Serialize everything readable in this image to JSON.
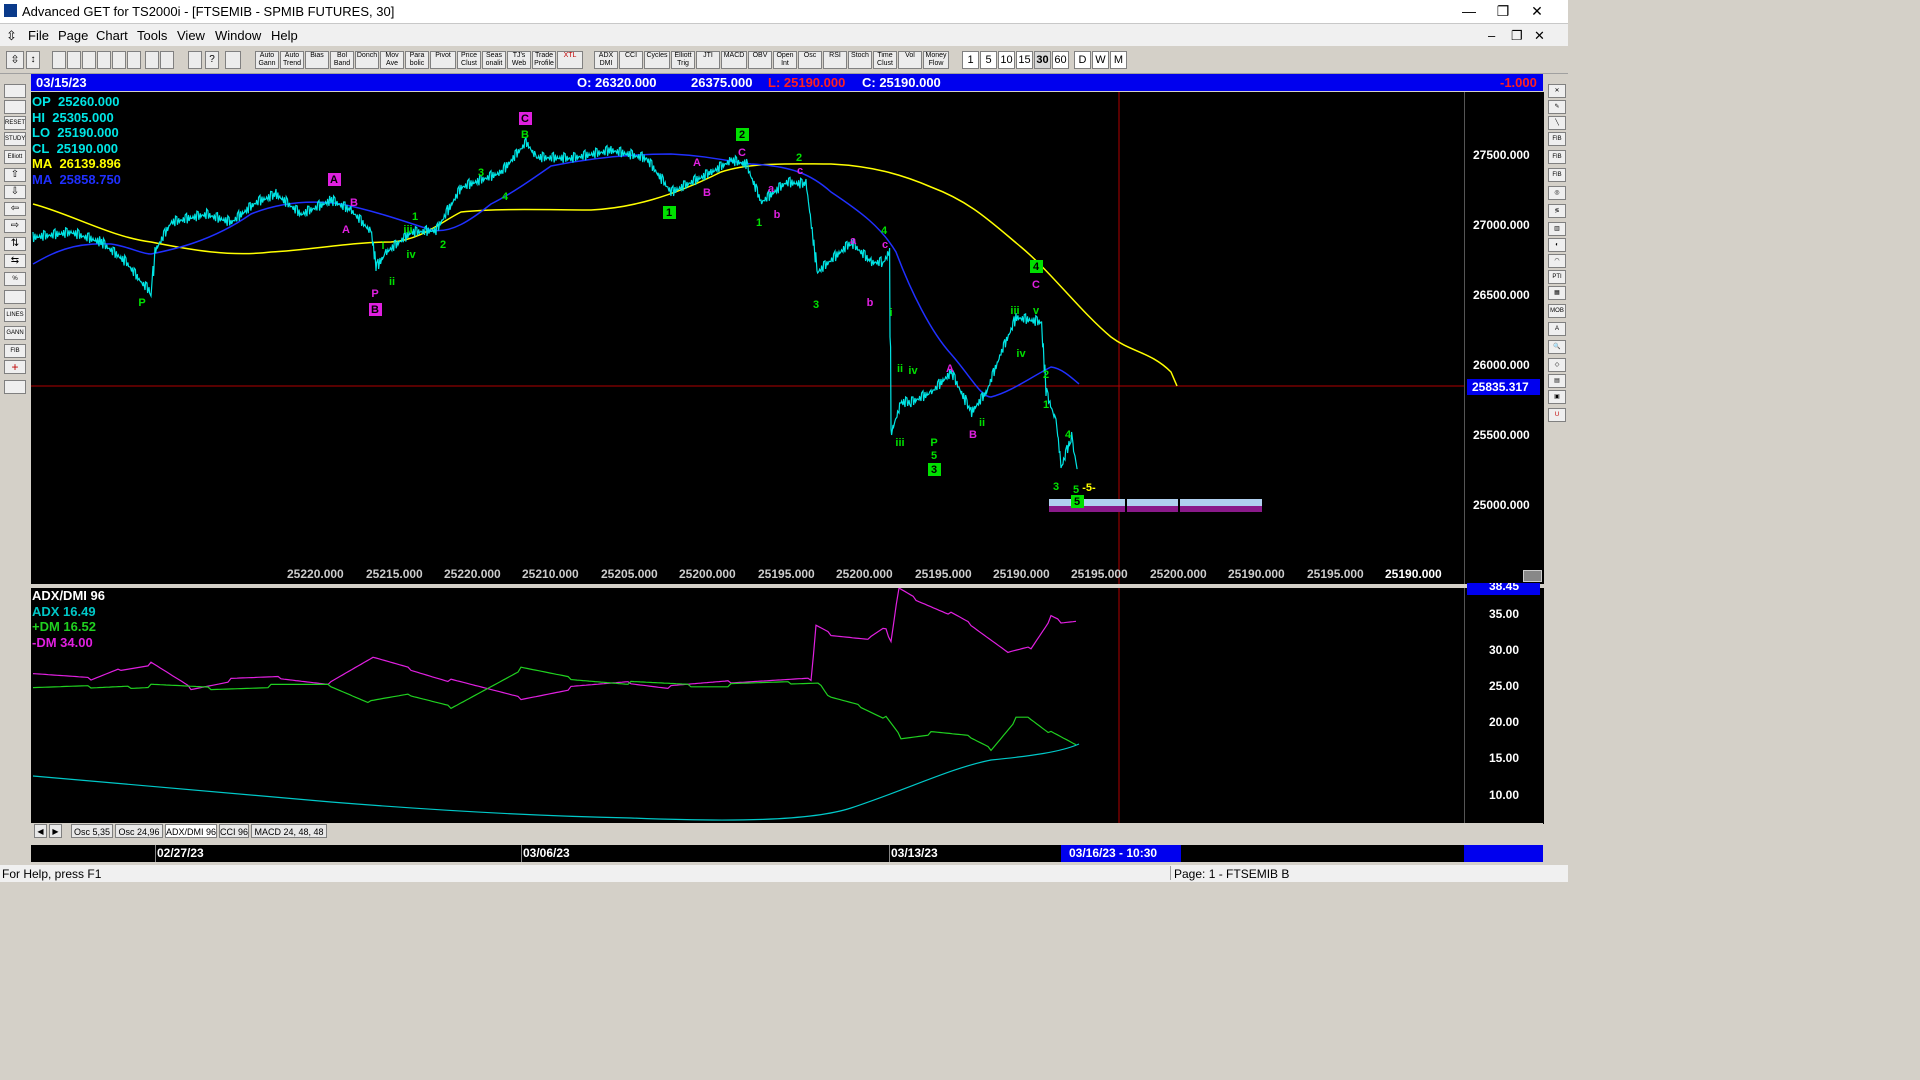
{
  "window": {
    "title": "Advanced GET for TS2000i - [FTSEMIB - SPMIB FUTURES, 30]",
    "controls": [
      "minimize-icon",
      "restore-icon",
      "close-icon"
    ]
  },
  "menu": [
    "File",
    "Page",
    "Chart",
    "Tools",
    "View",
    "Window",
    "Help"
  ],
  "toolbar": {
    "buttons": [
      "Auto Gann",
      "Auto Trend",
      "Bias",
      "Bol Band",
      "Donch",
      "Mov Ave",
      "Para bolic",
      "Pivot",
      "Price Clust",
      "Seas onalit",
      "TJ's Web",
      "Trade Profile",
      "XTL",
      "ADX DMI",
      "CCI",
      "Cycles",
      "Elliott Trig",
      "JTI",
      "MACD",
      "OBV",
      "Open Int",
      "Osc",
      "RSI",
      "Stoch",
      "Time Clust",
      "Vol",
      "Money Flow"
    ],
    "timeframes": [
      "1",
      "5",
      "10",
      "15",
      "30",
      "60",
      "D",
      "W",
      "M"
    ],
    "selected_timeframe": "30"
  },
  "info": {
    "date": "03/15/23",
    "open": "O: 26320.000",
    "high": "26375.000",
    "low": "L: 25190.000",
    "close": "C: 25190.000",
    "change": "-1.000"
  },
  "legend": [
    {
      "label": "OP",
      "value": "25260.000",
      "color": "#00e5e5"
    },
    {
      "label": "HI",
      "value": "25305.000",
      "color": "#00e5e5"
    },
    {
      "label": "LO",
      "value": "25190.000",
      "color": "#00e5e5"
    },
    {
      "label": "CL",
      "value": "25190.000",
      "color": "#00e5e5"
    },
    {
      "label": "MA",
      "value": "26139.896",
      "color": "#ffff00"
    },
    {
      "label": "MA",
      "value": "25858.750",
      "color": "#2020ff"
    }
  ],
  "price_axis": {
    "ticks": [
      "27500.000",
      "27000.000",
      "26500.000",
      "26000.000",
      "25500.000",
      "25000.000"
    ],
    "current_marker": "25835.317"
  },
  "bottom_values": [
    "25220.000",
    "25215.000",
    "25220.000",
    "25210.000",
    "25205.000",
    "25200.000",
    "25195.000",
    "25200.000",
    "25195.000",
    "25190.000",
    "25195.000",
    "25200.000",
    "25190.000",
    "25195.000",
    "25190.000"
  ],
  "wave_labels": [
    {
      "text": "P",
      "color": "#00e000",
      "box": false
    },
    {
      "text": "A",
      "color": "#e020e0",
      "box": true
    },
    {
      "text": "B",
      "color": "#e020e0",
      "box": false
    },
    {
      "text": "A",
      "color": "#e020e0",
      "box": false
    },
    {
      "text": "1",
      "color": "#00e000",
      "box": false
    },
    {
      "text": "iii",
      "color": "#00e000",
      "box": false
    },
    {
      "text": "iv",
      "color": "#00e000",
      "box": false
    },
    {
      "text": "2",
      "color": "#00e000",
      "box": false
    },
    {
      "text": "i",
      "color": "#00e000",
      "box": false
    },
    {
      "text": "ii",
      "color": "#00e000",
      "box": false
    },
    {
      "text": "P",
      "color": "#e020e0",
      "box": false
    },
    {
      "text": "B",
      "color": "#e020e0",
      "box": true
    },
    {
      "text": "3",
      "color": "#00e000",
      "box": false
    },
    {
      "text": "4",
      "color": "#00e000",
      "box": false
    },
    {
      "text": "C",
      "color": "#e020e0",
      "box": true
    },
    {
      "text": "B",
      "color": "#00e000",
      "box": false
    },
    {
      "text": "A",
      "color": "#e020e0",
      "box": false
    },
    {
      "text": "B",
      "color": "#e020e0",
      "box": false
    },
    {
      "text": "1",
      "color": "#00e000",
      "box": true
    },
    {
      "text": "2",
      "color": "#00e000",
      "box": true
    },
    {
      "text": "C",
      "color": "#e020e0",
      "box": false
    },
    {
      "text": "a",
      "color": "#e020e0",
      "box": false
    },
    {
      "text": "b",
      "color": "#e020e0",
      "box": false
    },
    {
      "text": "1",
      "color": "#00e000",
      "box": false
    },
    {
      "text": "2",
      "color": "#00e000",
      "box": false
    },
    {
      "text": "c",
      "color": "#e020e0",
      "box": false
    },
    {
      "text": "4",
      "color": "#00e000",
      "box": false
    },
    {
      "text": "c",
      "color": "#e020e0",
      "box": false
    },
    {
      "text": "a",
      "color": "#e020e0",
      "box": false
    },
    {
      "text": "3",
      "color": "#00e000",
      "box": false
    },
    {
      "text": "b",
      "color": "#e020e0",
      "box": false
    },
    {
      "text": "i",
      "color": "#00e000",
      "box": false
    },
    {
      "text": "ii",
      "color": "#00e000",
      "box": false
    },
    {
      "text": "iv",
      "color": "#00e000",
      "box": false
    },
    {
      "text": "iii",
      "color": "#00e000",
      "box": false
    },
    {
      "text": "P",
      "color": "#00e000",
      "box": false
    },
    {
      "text": "5",
      "color": "#00e000",
      "box": false
    },
    {
      "text": "3",
      "color": "#00e000",
      "box": true
    },
    {
      "text": "A",
      "color": "#e020e0",
      "box": false
    },
    {
      "text": "B",
      "color": "#e020e0",
      "box": false
    },
    {
      "text": "ii",
      "color": "#00e000",
      "box": false
    },
    {
      "text": "4",
      "color": "#00e000",
      "box": true
    },
    {
      "text": "C",
      "color": "#e020e0",
      "box": false
    },
    {
      "text": "iii",
      "color": "#00e000",
      "box": false
    },
    {
      "text": "v",
      "color": "#00e000",
      "box": false
    },
    {
      "text": "iv",
      "color": "#00e000",
      "box": false
    },
    {
      "text": "2",
      "color": "#00e000",
      "box": false
    },
    {
      "text": "1",
      "color": "#00e000",
      "box": false
    },
    {
      "text": "4",
      "color": "#00e000",
      "box": false
    },
    {
      "text": "3",
      "color": "#00e000",
      "box": false
    },
    {
      "text": "5",
      "color": "#00e000",
      "box": false
    },
    {
      "text": "5",
      "color": "#00e000",
      "box": true
    },
    {
      "text": "-5-",
      "color": "#ffff00",
      "box": false
    }
  ],
  "indicator": {
    "title": "ADX/DMI 96",
    "adx": "ADX 16.49",
    "plus_dm": "+DM 16.52",
    "minus_dm": "-DM 34.00",
    "axis_ticks": [
      "35.00",
      "30.00",
      "25.00",
      "20.00",
      "15.00",
      "10.00"
    ],
    "top_clipped": "38.45"
  },
  "tabs": [
    "Osc 5,35",
    "Osc 24,96",
    "ADX/DMI 96",
    "CCI 96",
    "MACD 24, 48, 48"
  ],
  "selected_tab": "ADX/DMI 96",
  "dates": [
    "02/27/23",
    "03/06/23",
    "03/13/23",
    "03/16/23 - 10:30"
  ],
  "status": {
    "left": "For Help, press F1",
    "right": "Page: 1 - FTSEMIB B"
  }
}
